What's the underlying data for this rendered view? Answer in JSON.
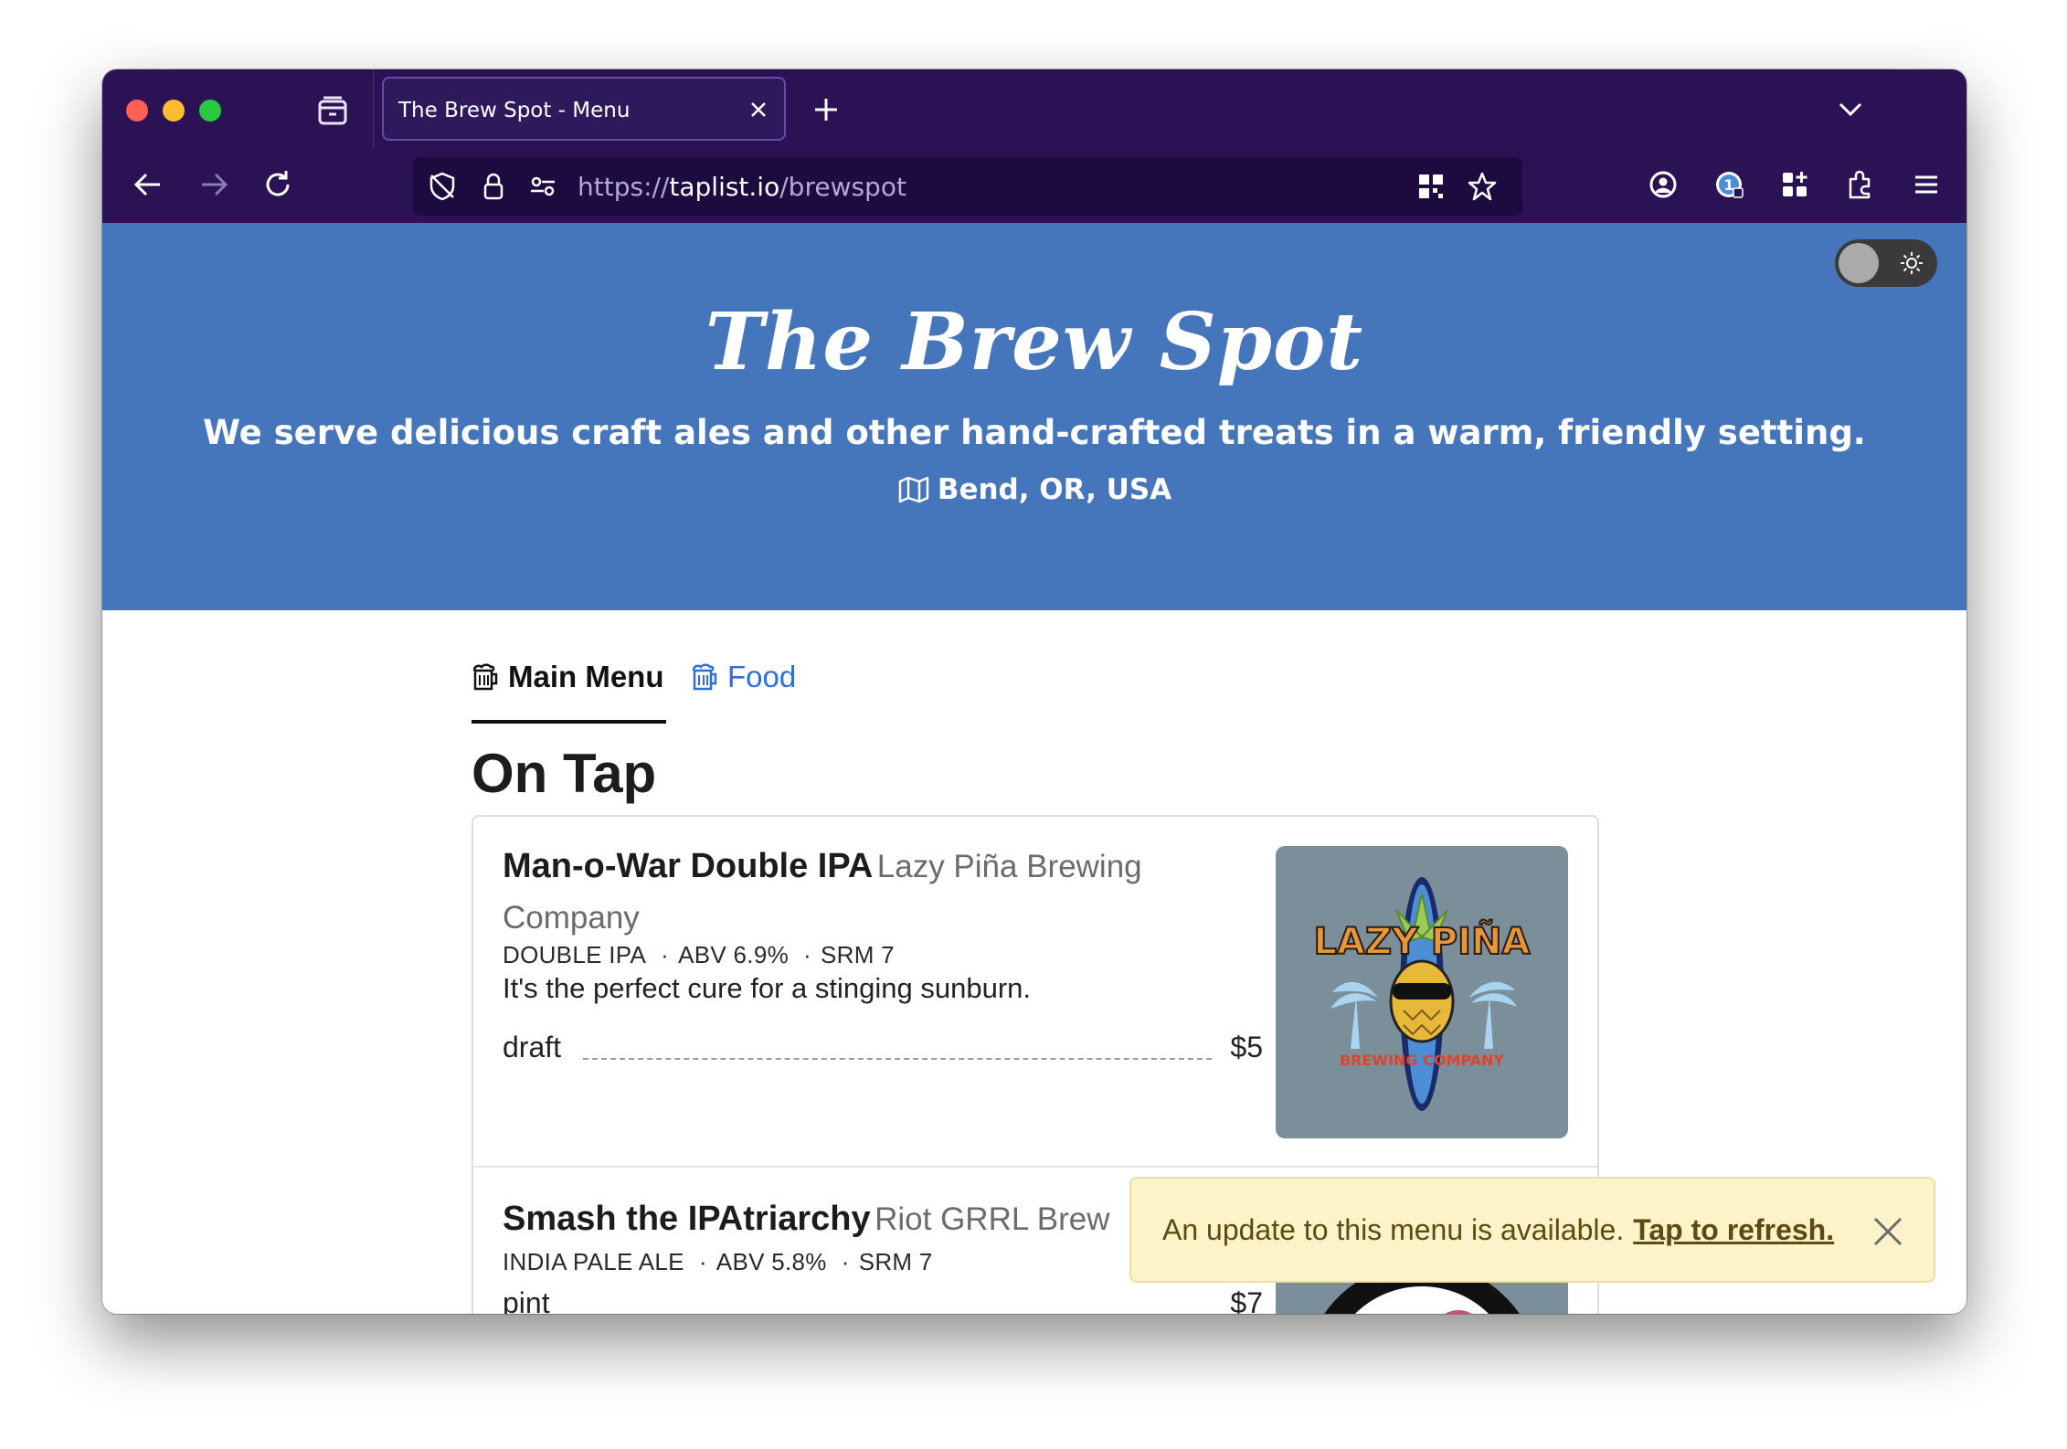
{
  "browser": {
    "tab_title": "The Brew Spot - Menu",
    "url_prefix": "https://",
    "url_host": "taplist.io",
    "url_path": "/brewspot"
  },
  "hero": {
    "title": "The Brew Spot",
    "description": "We serve delicious craft ales and other hand-crafted treats in a warm, friendly setting.",
    "location": "Bend, OR, USA",
    "background_color": "#4575bb"
  },
  "nav": {
    "tabs": [
      {
        "label": "Main Menu",
        "active": true
      },
      {
        "label": "Food",
        "active": false
      }
    ]
  },
  "section": {
    "title": "On Tap"
  },
  "beers": [
    {
      "name": "Man-o-War Double IPA",
      "brewery": "Lazy Piña Brewing Company",
      "style": "DOUBLE IPA",
      "abv": "ABV 6.9%",
      "srm": "SRM 7",
      "description": "It's the perfect cure for a stinging sunburn.",
      "serving": "draft",
      "price": "$5",
      "logo_text_top": "LAZY PIÑA",
      "logo_text_bottom": "BREWING COMPANY"
    },
    {
      "name": "Smash the IPAtriarchy",
      "brewery": "Riot GRRL Brew",
      "style": "INDIA PALE ALE",
      "abv": "ABV 5.8%",
      "srm": "SRM 7",
      "serving": "pint",
      "price": "$7"
    }
  ],
  "toast": {
    "message": "An update to this menu is available.",
    "link": "Tap to refresh."
  },
  "icons": [
    "tab-list-icon",
    "close-icon",
    "plus-icon",
    "chevron-down-icon",
    "back-arrow-icon",
    "forward-arrow-icon",
    "reload-icon",
    "tracking-shield-icon",
    "lock-icon",
    "permissions-icon",
    "qr-code-icon",
    "bookmark-star-icon",
    "account-icon",
    "extension-icon",
    "puzzle-icon",
    "hamburger-menu-icon",
    "sun-icon",
    "map-icon",
    "beer-mug-icon"
  ]
}
